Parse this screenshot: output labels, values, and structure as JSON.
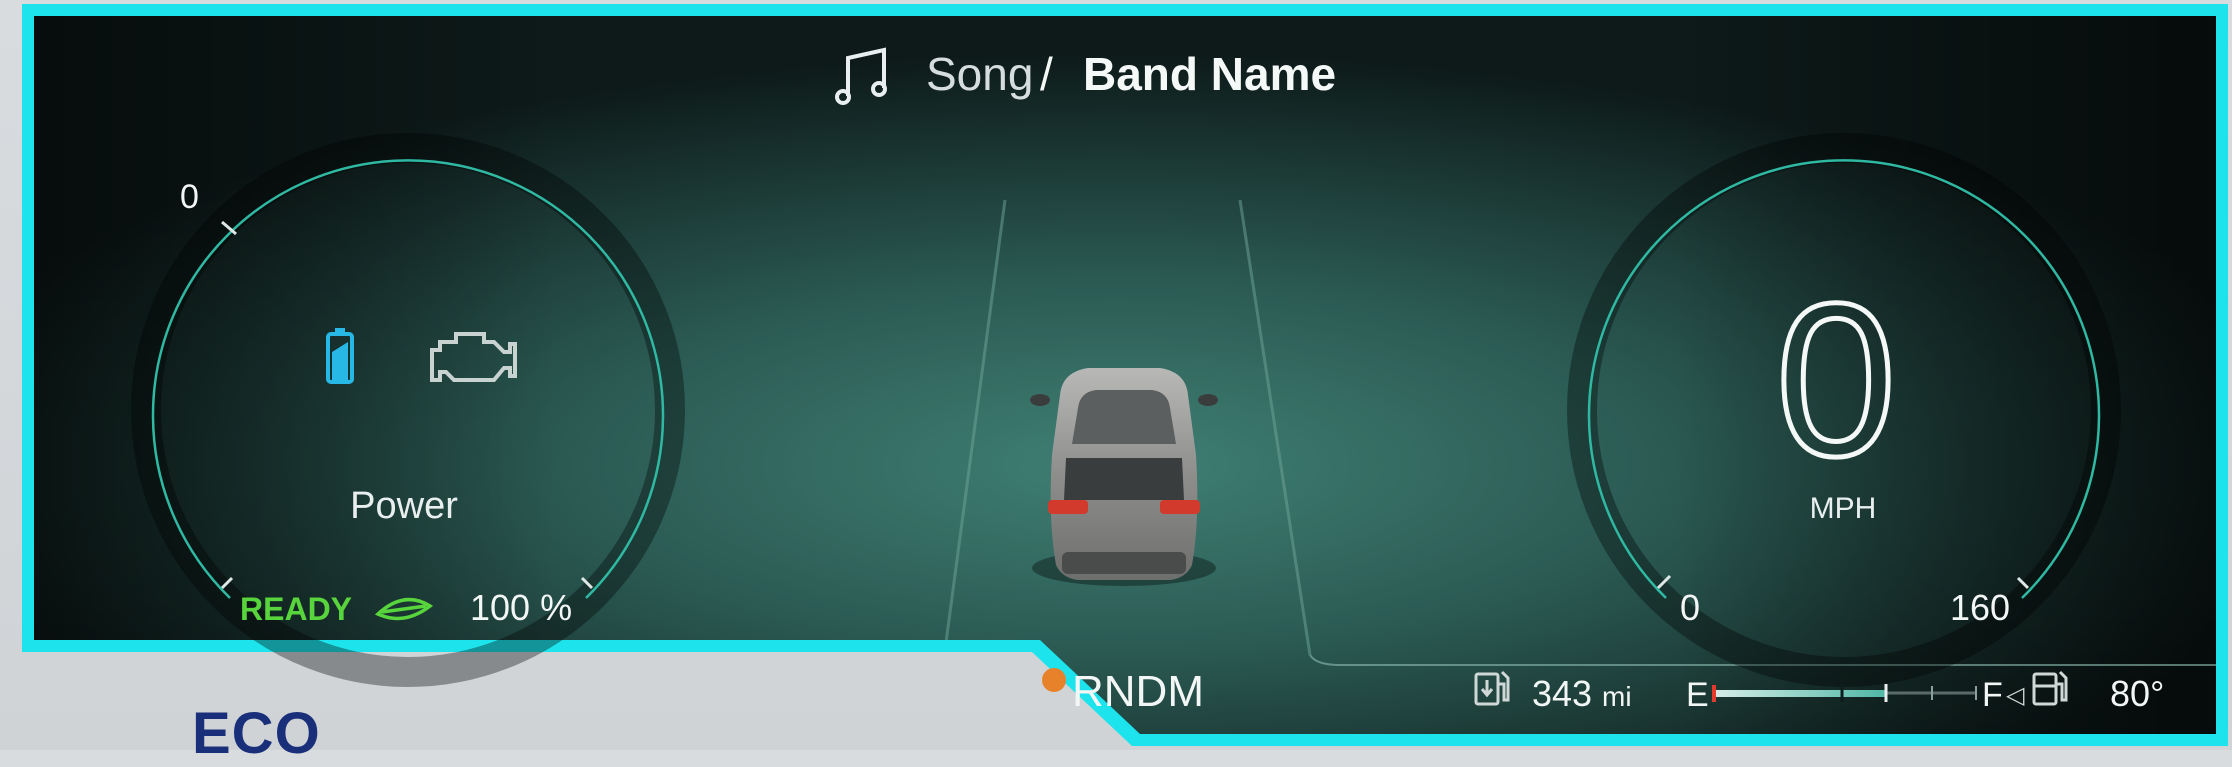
{
  "media": {
    "song": "Song",
    "separator": "/",
    "band": "Band Name",
    "icon": "music-note-icon"
  },
  "power_gauge": {
    "scale_max": "0",
    "label": "Power",
    "battery_icon": "battery-icon",
    "engine_icon": "engine-icon",
    "status": "READY",
    "eco_leaf_icon": "leaf-icon",
    "charge": "100 %"
  },
  "speedometer": {
    "speed": "0",
    "unit": "MPH",
    "scale_min": "0",
    "scale_max": "160"
  },
  "gear_selector": {
    "label": "RNDM",
    "active_indicator_color": "#e8822a"
  },
  "bottom_bar": {
    "range_icon": "fuel-range-icon",
    "range_value": "343",
    "range_unit": "mi",
    "fuel_empty": "E",
    "fuel_full": "F",
    "fuel_door_arrow": "◁",
    "fuel_pump_icon": "fuel-pump-icon",
    "temperature": "80°"
  },
  "mode_label": "ECO",
  "colors": {
    "frame": "#1de4ec",
    "accent_teal": "#2fd3c1",
    "ready_green": "#58d43c",
    "battery_blue": "#27b8e6",
    "eco_label": "#1a2f7a"
  }
}
